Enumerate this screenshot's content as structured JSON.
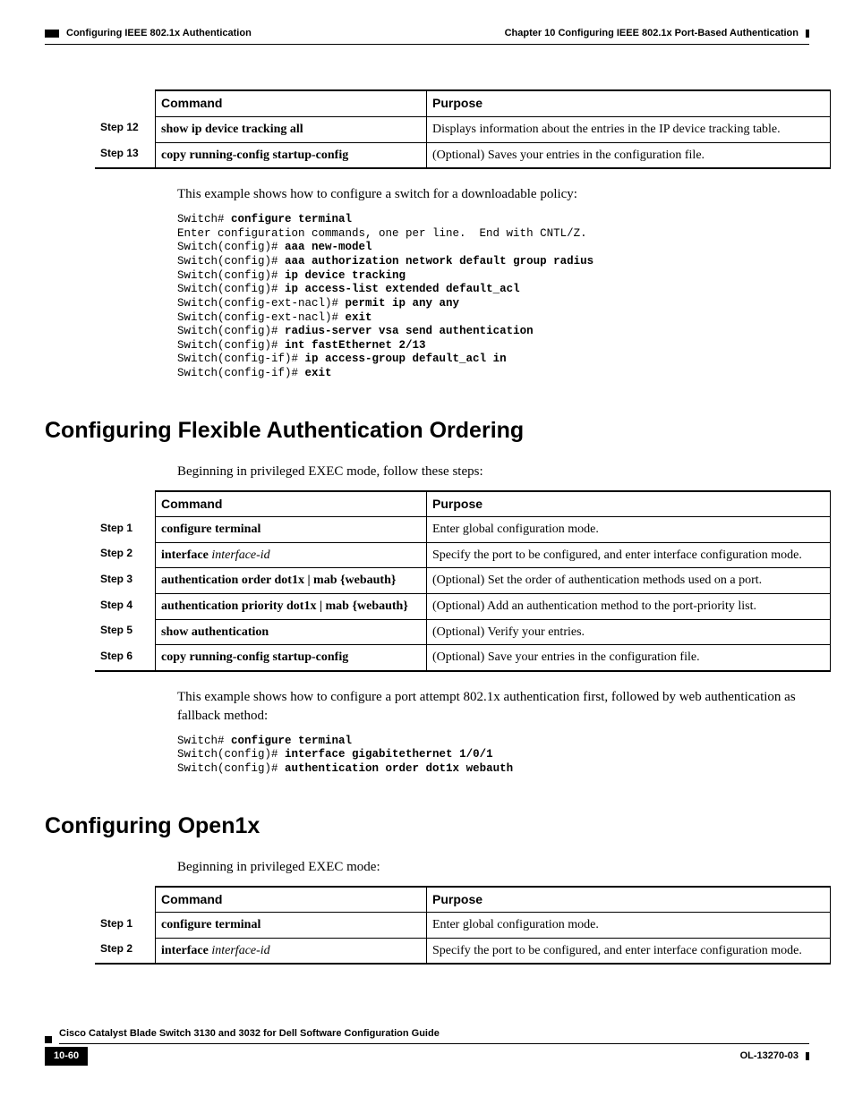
{
  "header": {
    "chapter": "Chapter 10    Configuring IEEE 802.1x Port-Based Authentication",
    "section": "Configuring IEEE 802.1x Authentication"
  },
  "table1": {
    "h_command": "Command",
    "h_purpose": "Purpose",
    "rows": [
      {
        "step": "Step 12",
        "cmd_b": "show ip device tracking all",
        "purpose": "Displays information about the entries in the IP device tracking table."
      },
      {
        "step": "Step 13",
        "cmd_b": "copy running-config startup-config",
        "purpose": "(Optional) Saves your entries in the configuration file."
      }
    ]
  },
  "para1": "This example shows how to configure a switch for a downloadable policy:",
  "cli1": {
    "l1a": "Switch# ",
    "l1b": "configure terminal",
    "l2": "Enter configuration commands, one per line.  End with CNTL/Z.",
    "l3a": "Switch(config)# ",
    "l3b": "aaa new-model",
    "l4a": "Switch(config)# ",
    "l4b": "aaa authorization network default group radius",
    "l5a": "Switch(config)# ",
    "l5b": "ip device tracking",
    "l6a": "Switch(config)# ",
    "l6b": "ip access-list extended default_acl",
    "l7a": "Switch(config-ext-nacl)# ",
    "l7b": "permit ip any any",
    "l8a": "Switch(config-ext-nacl)# ",
    "l8b": "exit",
    "l9a": "Switch(config)# ",
    "l9b": "radius-server vsa send authentication",
    "l10a": "Switch(config)# ",
    "l10b": "int fastEthernet 2/13",
    "l11a": "Switch(config-if)# ",
    "l11b": "ip access-group default_acl in",
    "l12a": "Switch(config-if)# ",
    "l12b": "exit"
  },
  "h2a": "Configuring Flexible Authentication Ordering",
  "para2": "Beginning in privileged EXEC mode, follow these steps:",
  "table2": {
    "h_command": "Command",
    "h_purpose": "Purpose",
    "rows": [
      {
        "step": "Step 1",
        "cmd": "<b>configure terminal</b>",
        "purpose": "Enter global configuration mode."
      },
      {
        "step": "Step 2",
        "cmd": "<b>interface</b> <i>interface-id</i>",
        "purpose": "Specify the port to be configured, and enter interface configuration mode."
      },
      {
        "step": "Step 3",
        "cmd": "<b>authentication order dot1x | mab {webauth}</b>",
        "purpose": "(Optional) Set the order of authentication methods used on a port."
      },
      {
        "step": "Step 4",
        "cmd": "<b>authentication priority dot1x | mab {webauth}</b>",
        "purpose": "(Optional) Add an authentication method to the port-priority list."
      },
      {
        "step": "Step 5",
        "cmd": "<b>show authentication</b>",
        "purpose": "(Optional) Verify your entries."
      },
      {
        "step": "Step 6",
        "cmd": "<b>copy running-config startup-config</b>",
        "purpose": "(Optional) Save your entries in the configuration file."
      }
    ]
  },
  "para3": "This example shows how to configure a port attempt 802.1x authentication first, followed by web authentication as fallback method:",
  "cli2": {
    "l1a": "Switch# ",
    "l1b": "configure terminal",
    "l2a": "Switch(config)# ",
    "l2b": "interface gigabitethernet 1/0/1",
    "l3a": "Switch(config)# ",
    "l3b": "authentication order dot1x webauth"
  },
  "h2b": "Configuring Open1x",
  "para4": "Beginning in privileged EXEC mode:",
  "table3": {
    "h_command": "Command",
    "h_purpose": "Purpose",
    "rows": [
      {
        "step": "Step 1",
        "cmd": "<b>configure terminal</b>",
        "purpose": "Enter global configuration mode."
      },
      {
        "step": "Step 2",
        "cmd": "<b>interface</b> <i>interface-id</i>",
        "purpose": "Specify the port to be configured, and enter interface configuration mode."
      }
    ]
  },
  "footer": {
    "title": "Cisco Catalyst Blade Switch 3130 and 3032 for Dell Software Configuration Guide",
    "page": "10-60",
    "docid": "OL-13270-03"
  }
}
